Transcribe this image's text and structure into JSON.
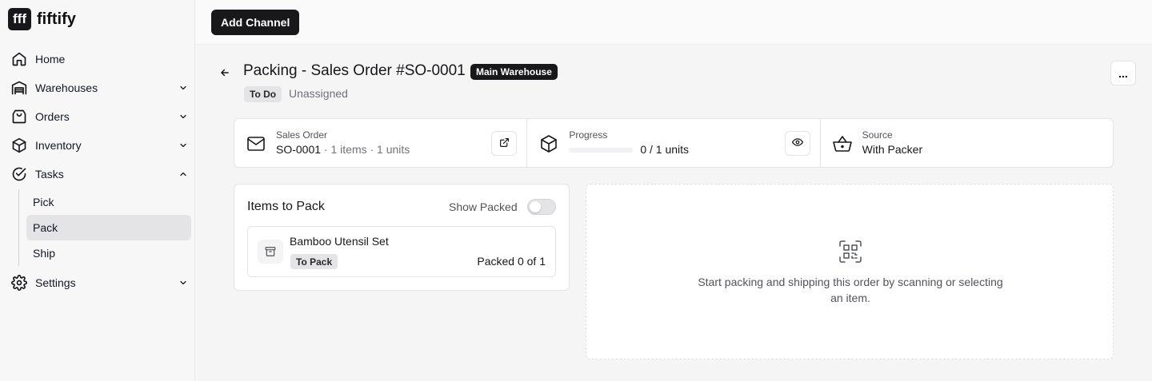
{
  "brand": {
    "logo_text": "fff",
    "name": "fiftify"
  },
  "sidebar": {
    "items": [
      {
        "label": "Home",
        "icon": "home-icon"
      },
      {
        "label": "Warehouses",
        "icon": "warehouse-icon"
      },
      {
        "label": "Orders",
        "icon": "clipboard-icon"
      },
      {
        "label": "Inventory",
        "icon": "box-icon"
      },
      {
        "label": "Tasks",
        "icon": "check-circle-icon"
      },
      {
        "label": "Settings",
        "icon": "gear-icon"
      }
    ],
    "task_subitems": [
      {
        "label": "Pick"
      },
      {
        "label": "Pack",
        "active": true
      },
      {
        "label": "Ship"
      }
    ]
  },
  "topbar": {
    "add_channel_label": "Add Channel"
  },
  "header": {
    "title": "Packing - Sales Order #SO-0001",
    "warehouse_badge": "Main Warehouse",
    "status": "To Do",
    "assignee": "Unassigned",
    "more_label": "..."
  },
  "info": {
    "sales_order": {
      "label": "Sales Order",
      "value": "SO-0001",
      "detail": " · 1 items · 1 units"
    },
    "progress": {
      "label": "Progress",
      "value": "0 / 1 units",
      "fraction": 0
    },
    "source": {
      "label": "Source",
      "value": "With Packer"
    }
  },
  "items_panel": {
    "title": "Items to Pack",
    "toggle_label": "Show Packed",
    "toggle_on": false,
    "items": [
      {
        "name": "Bamboo Utensil Set",
        "status": "To Pack",
        "packed": "Packed 0 of 1"
      }
    ]
  },
  "scan_panel": {
    "message": "Start packing and shipping this order by scanning or selecting an item.",
    "icon": "scan-qr-icon"
  },
  "colors": {
    "primary": "#18181b",
    "muted": "#71717a",
    "border": "#e4e4e7"
  }
}
